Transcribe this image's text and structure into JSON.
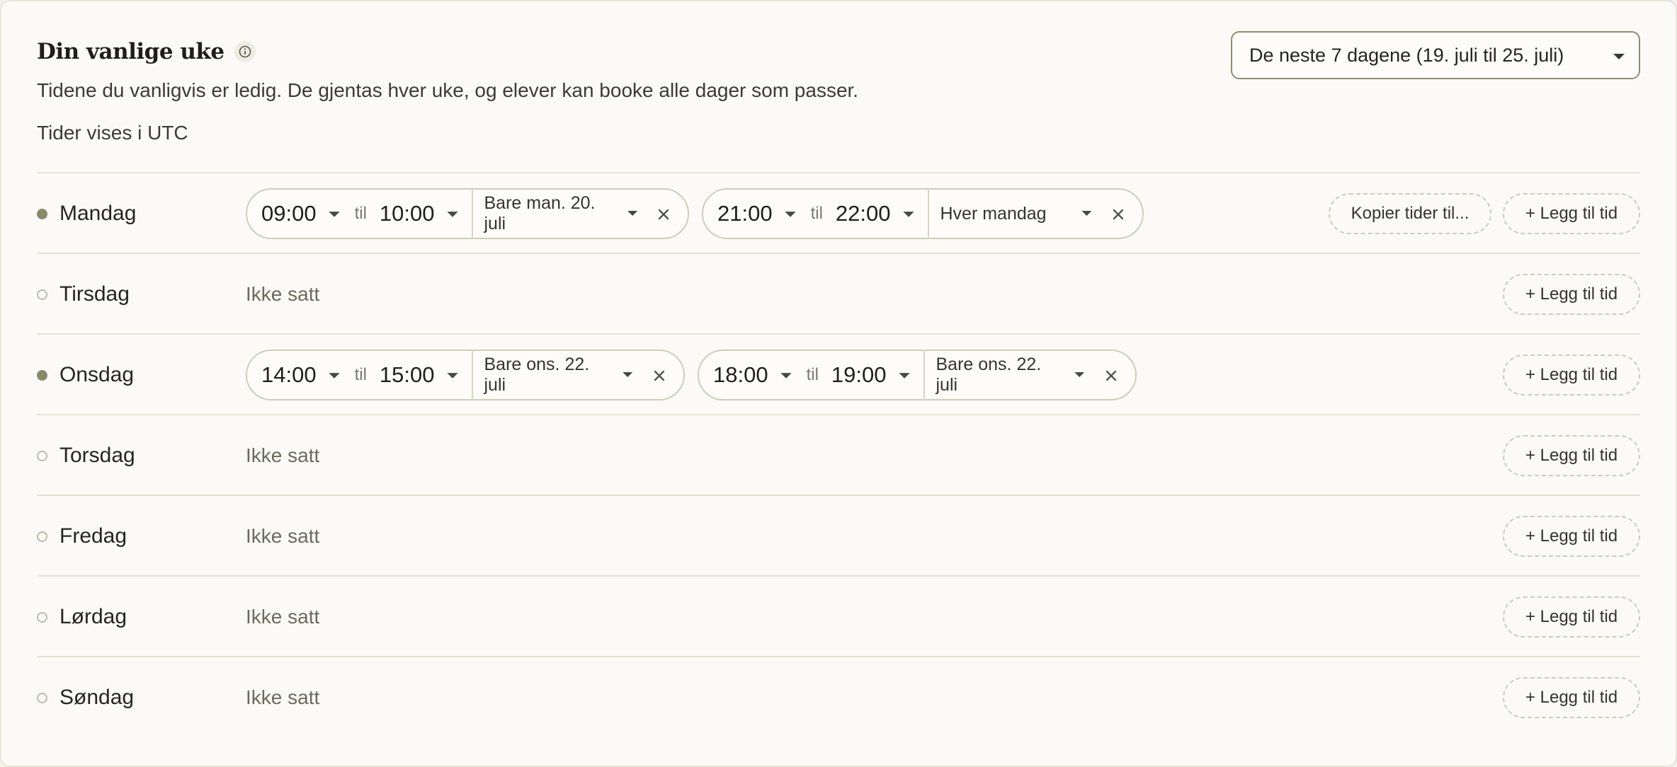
{
  "header": {
    "title": "Din vanlige uke",
    "subtitle": "Tidene du vanligvis er ledig. De gjentas hver uke, og elever kan booke alle dager som passer.",
    "timezone_note": "Tider vises i UTC",
    "range_select_value": "De neste 7 dagene (19. juli til 25. juli)"
  },
  "labels": {
    "til": "til",
    "not_set": "Ikke satt",
    "add_time": "+ Legg til tid",
    "copy_times": "Kopier tider til..."
  },
  "colors": {
    "accent_dot": "#868a6b",
    "card_bg": "#fbfaf6"
  },
  "days": [
    {
      "name": "Mandag",
      "active": true,
      "slots": [
        {
          "start": "09:00",
          "end": "10:00",
          "repeat": "Bare man. 20. juli"
        },
        {
          "start": "21:00",
          "end": "22:00",
          "repeat": "Hver mandag"
        }
      ]
    },
    {
      "name": "Tirsdag",
      "active": false,
      "slots": []
    },
    {
      "name": "Onsdag",
      "active": true,
      "slots": [
        {
          "start": "14:00",
          "end": "15:00",
          "repeat": "Bare ons. 22. juli"
        },
        {
          "start": "18:00",
          "end": "19:00",
          "repeat": "Bare ons. 22. juli"
        }
      ]
    },
    {
      "name": "Torsdag",
      "active": false,
      "slots": []
    },
    {
      "name": "Fredag",
      "active": false,
      "slots": []
    },
    {
      "name": "Lørdag",
      "active": false,
      "slots": []
    },
    {
      "name": "Søndag",
      "active": false,
      "slots": []
    }
  ]
}
